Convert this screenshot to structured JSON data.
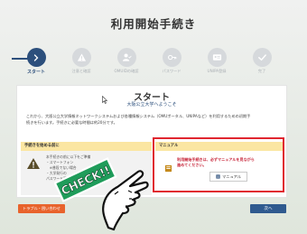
{
  "page_title": "利用開始手続き",
  "steps": [
    {
      "label": "スタート",
      "active": true
    },
    {
      "label": "注意と確認"
    },
    {
      "label": "OMUIDの確認"
    },
    {
      "label": "パスワード"
    },
    {
      "label": "UNIPA登録"
    },
    {
      "label": "完了"
    }
  ],
  "card": {
    "heading": "スタート",
    "welcome": "大阪公立大学へようこそ",
    "intro_line1": "これから、大阪公立大学情報ネットワークシステムおよび各種情報システム（OMUポータル、UNIPAなど）を利用するための初期手",
    "intro_line2": "続きを行います。手続きに必要な時間は約20分です。"
  },
  "left_panel": {
    "heading": "手続きを始める前に",
    "line1": "本手続きの前に以下をご準備",
    "line2": "・スマートフォン",
    "line3": "　※普段でない場合",
    "line4": "・大学発行の",
    "line5": "パスワード再発行"
  },
  "right_panel": {
    "heading": "マニュアル",
    "notice_line1": "利用開始手続きは、必ずマニュアルを見ながら",
    "notice_line2": "進めてください。",
    "manual_button": "マニュアル"
  },
  "sticker": {
    "text": "CHECK!!"
  },
  "footer": {
    "trouble_button": "トラブル・困い合わせ",
    "next_button": "次へ"
  },
  "colors": {
    "primary": "#2c4f7c",
    "accent_orange": "#e8632c",
    "alert_red": "#e0262f",
    "panel_yellow": "#fbe6a2"
  }
}
